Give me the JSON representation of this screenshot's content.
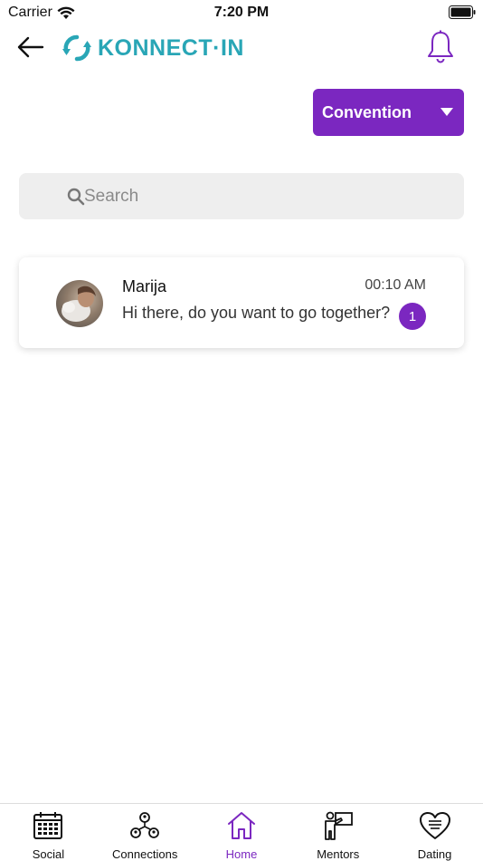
{
  "status_bar": {
    "carrier": "Carrier",
    "time": "7:20 PM"
  },
  "header": {
    "logo_text_main": "KONNECT",
    "logo_text_dot": "·",
    "logo_text_suffix": "IN",
    "brand_color": "#29a6b6"
  },
  "event_selector": {
    "selected": "Convention",
    "color": "#7b27c0"
  },
  "search": {
    "placeholder": "Search",
    "value": ""
  },
  "chats": [
    {
      "name": "Marija",
      "time": "00:10 AM",
      "preview": "Hi there, do you want to go together?",
      "unread": "1"
    }
  ],
  "tabs": [
    {
      "label": "Social",
      "icon": "calendar-icon",
      "active": false
    },
    {
      "label": "Connections",
      "icon": "network-icon",
      "active": false
    },
    {
      "label": "Home",
      "icon": "home-icon",
      "active": true
    },
    {
      "label": "Mentors",
      "icon": "presenter-icon",
      "active": false
    },
    {
      "label": "Dating",
      "icon": "heart-icon",
      "active": false
    }
  ],
  "colors": {
    "accent": "#7b27c0",
    "search_bg": "#eeeeee"
  }
}
